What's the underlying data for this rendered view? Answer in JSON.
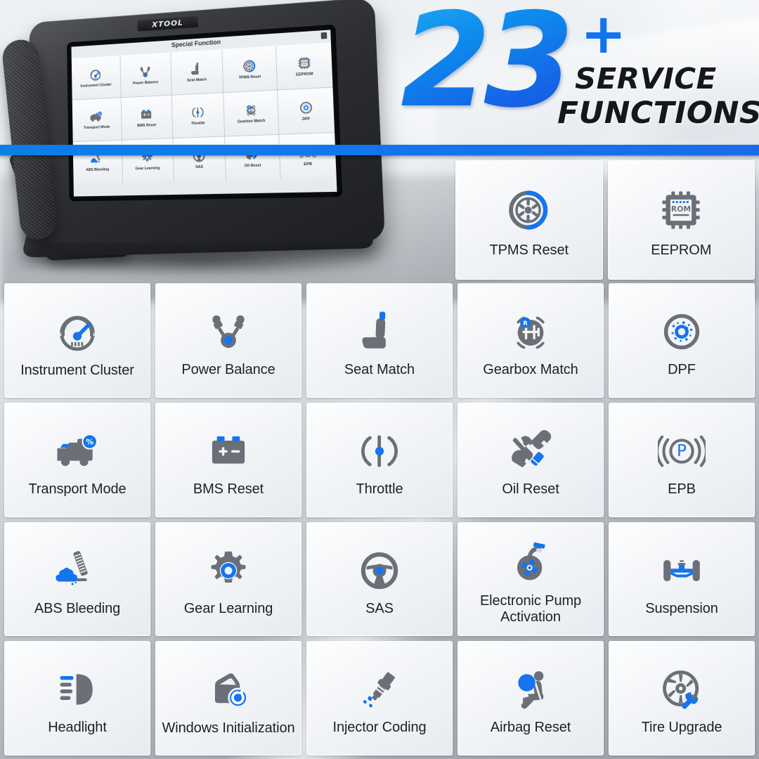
{
  "headline": {
    "number": "23",
    "plus": "+",
    "line1": "SERVICE",
    "line2": "FUNCTIONS",
    "accent_blue": "#1273ef",
    "text_color": "#15171a"
  },
  "device": {
    "brand": "XTOOL",
    "screen_title": "Special Function",
    "back_icon": "back-arrow-icon",
    "battery_icon": "battery-icon",
    "screen_tiles": [
      {
        "label": "Instrument Cluster",
        "icon": "gauge-icon"
      },
      {
        "label": "Power Balance",
        "icon": "piston-v-icon"
      },
      {
        "label": "Seat Match",
        "icon": "car-seat-icon"
      },
      {
        "label": "TPMS Reset",
        "icon": "tire-pressure-icon"
      },
      {
        "label": "EEPROM",
        "icon": "rom-chip-icon"
      },
      {
        "label": "Transport Mode",
        "icon": "truck-icon"
      },
      {
        "label": "BMS Reset",
        "icon": "battery-pack-icon"
      },
      {
        "label": "Throttle",
        "icon": "throttle-body-icon"
      },
      {
        "label": "Gearbox Match",
        "icon": "gear-shifter-icon"
      },
      {
        "label": "DPF",
        "icon": "dpf-filter-icon"
      },
      {
        "label": "ABS Bleeding",
        "icon": "brake-pedal-fluid-icon"
      },
      {
        "label": "Gear Learning",
        "icon": "cog-icon"
      },
      {
        "label": "SAS",
        "icon": "steering-wheel-icon"
      },
      {
        "label": "Oil Reset",
        "icon": "wrench-screwdriver-icon"
      },
      {
        "label": "EPB",
        "icon": "parking-brake-icon"
      }
    ]
  },
  "top_tiles": [
    {
      "label": "TPMS Reset",
      "icon": "tire-pressure-icon"
    },
    {
      "label": "EEPROM",
      "icon": "rom-chip-icon"
    }
  ],
  "main_tiles": [
    {
      "label": "Instrument Cluster",
      "icon": "gauge-icon",
      "lines": 2
    },
    {
      "label": "Power Balance",
      "icon": "piston-v-icon",
      "lines": 1
    },
    {
      "label": "Seat Match",
      "icon": "car-seat-icon",
      "lines": 1
    },
    {
      "label": "Gearbox Match",
      "icon": "gear-shifter-icon",
      "lines": 1
    },
    {
      "label": "DPF",
      "icon": "dpf-filter-icon",
      "lines": 1
    },
    {
      "label": "Transport Mode",
      "icon": "truck-icon",
      "lines": 1
    },
    {
      "label": "BMS Reset",
      "icon": "battery-pack-icon",
      "lines": 1
    },
    {
      "label": "Throttle",
      "icon": "throttle-body-icon",
      "lines": 1
    },
    {
      "label": "Oil Reset",
      "icon": "wrench-screwdriver-icon",
      "lines": 1
    },
    {
      "label": "EPB",
      "icon": "parking-brake-icon",
      "lines": 1
    },
    {
      "label": "ABS Bleeding",
      "icon": "brake-pedal-fluid-icon",
      "lines": 1
    },
    {
      "label": "Gear Learning",
      "icon": "cog-icon",
      "lines": 1
    },
    {
      "label": "SAS",
      "icon": "steering-wheel-icon",
      "lines": 1
    },
    {
      "label": "Electronic Pump Activation",
      "icon": "electronic-pump-icon",
      "lines": 2
    },
    {
      "label": "Suspension",
      "icon": "suspension-axle-icon",
      "lines": 1
    },
    {
      "label": "Headlight",
      "icon": "headlight-beam-icon",
      "lines": 1
    },
    {
      "label": "Windows Initialization",
      "icon": "car-door-refresh-icon",
      "lines": 2
    },
    {
      "label": "Injector Coding",
      "icon": "fuel-injector-icon",
      "lines": 1
    },
    {
      "label": "Airbag Reset",
      "icon": "airbag-occupant-icon",
      "lines": 1
    },
    {
      "label": "Tire Upgrade",
      "icon": "wheel-wrench-icon",
      "lines": 1
    }
  ],
  "theme": {
    "icon_gray": "#6b7078",
    "icon_blue": "#1574ee",
    "tile_bg_top": "#fdfefe",
    "tile_bg_bottom": "#e7ebf0",
    "divider_blue": "#0f79e8"
  }
}
